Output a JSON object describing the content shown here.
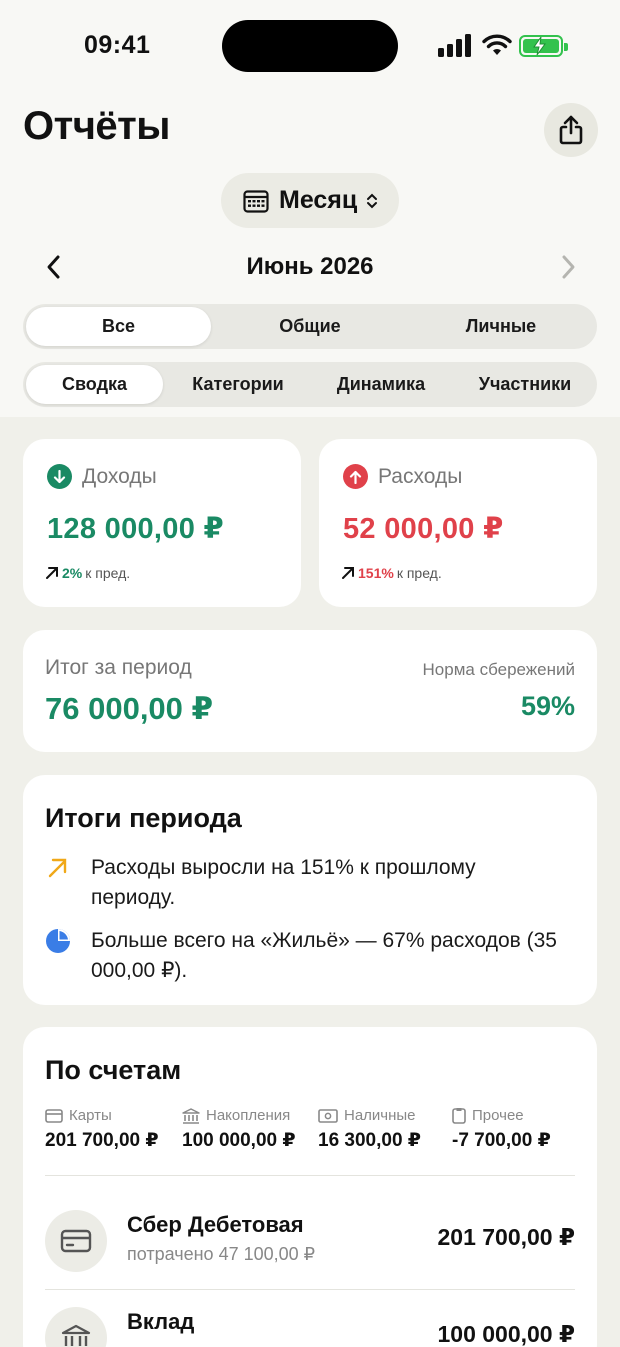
{
  "status_bar": {
    "time": "09:41"
  },
  "header": {
    "title": "Отчёты"
  },
  "period": {
    "label": "Месяц",
    "month": "Июнь 2026"
  },
  "scope_tabs": [
    {
      "label": "Все",
      "active": true
    },
    {
      "label": "Общие",
      "active": false
    },
    {
      "label": "Личные",
      "active": false
    }
  ],
  "view_tabs": [
    {
      "label": "Сводка",
      "active": true
    },
    {
      "label": "Категории",
      "active": false
    },
    {
      "label": "Динамика",
      "active": false
    },
    {
      "label": "Участники",
      "active": false
    }
  ],
  "income": {
    "title": "Доходы",
    "amount": "128 000,00 ₽",
    "delta_pct": "2%",
    "delta_suffix": "к пред.",
    "color": "#1a8a64"
  },
  "expense": {
    "title": "Расходы",
    "amount": "52 000,00 ₽",
    "delta_pct": "151%",
    "delta_suffix": "к пред.",
    "color": "#e0414a"
  },
  "total": {
    "label": "Итог за период",
    "amount": "76 000,00 ₽",
    "savings_label": "Норма сбережений",
    "savings_value": "59%"
  },
  "insights": {
    "title": "Итоги периода",
    "items": [
      {
        "icon": "arrow-up-right-icon",
        "text": "Расходы выросли на 151% к прошлому периоду."
      },
      {
        "icon": "pie-chart-icon",
        "text": "Больше всего на «Жильё» — 67% расходов (35 000,00 ₽)."
      }
    ]
  },
  "accounts": {
    "title": "По счетам",
    "summary": [
      {
        "icon": "card-icon",
        "label": "Карты",
        "value": "201 700,00 ₽"
      },
      {
        "icon": "bank-icon",
        "label": "Накопления",
        "value": "100 000,00 ₽"
      },
      {
        "icon": "cash-icon",
        "label": "Наличные",
        "value": "16 300,00 ₽"
      },
      {
        "icon": "note-icon",
        "label": "Прочее",
        "value": "-7 700,00 ₽"
      }
    ],
    "rows": [
      {
        "icon": "card-icon",
        "name": "Сбер Дебетовая",
        "spent": "потрачено 47 100,00 ₽",
        "amount": "201 700,00 ₽"
      },
      {
        "icon": "bank-icon",
        "name": "Вклад",
        "spent": "",
        "amount": "100 000,00 ₽"
      }
    ]
  }
}
